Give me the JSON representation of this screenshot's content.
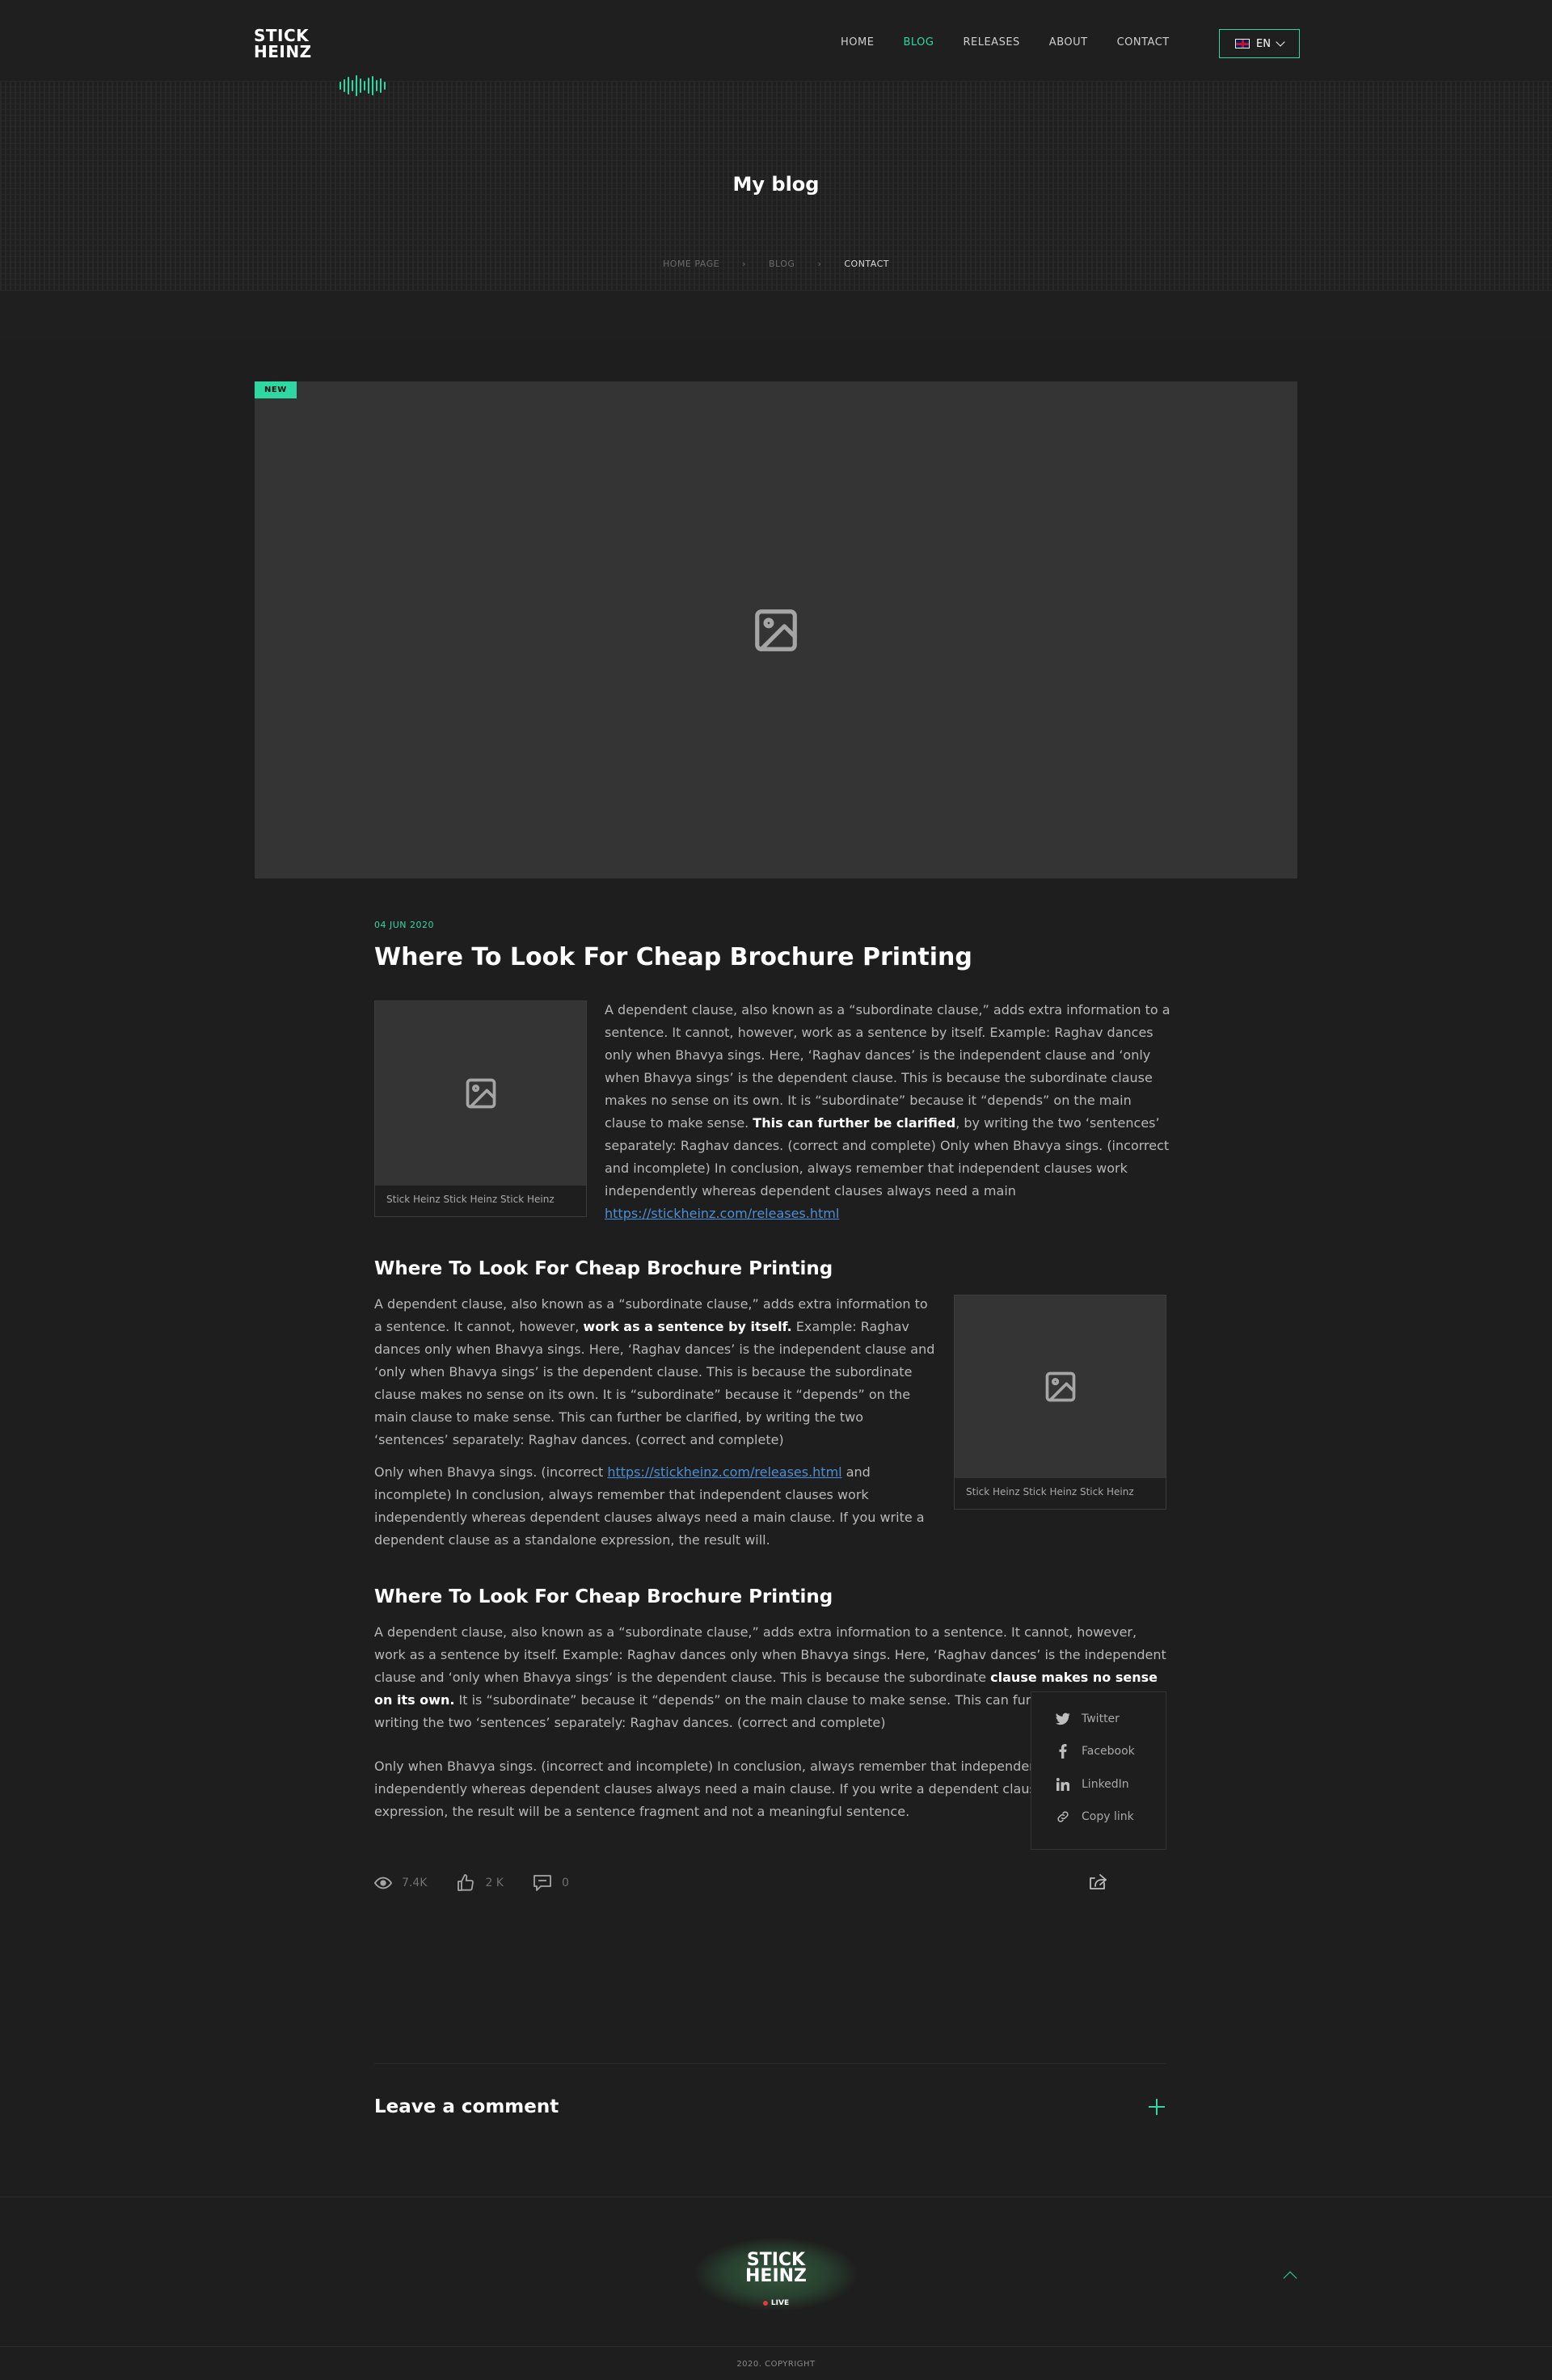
{
  "header": {
    "logo_line1": "STICK",
    "logo_line2": "HEINZ",
    "nav": [
      {
        "label": "HOME",
        "active": false
      },
      {
        "label": "BLOG",
        "active": true
      },
      {
        "label": "RELEASES",
        "active": false
      },
      {
        "label": "ABOUT",
        "active": false
      },
      {
        "label": "CONTACT",
        "active": false
      }
    ],
    "language": "EN",
    "accent_color": "#2ed8a3"
  },
  "hero": {
    "title": "My blog",
    "breadcrumb": [
      "HOME PAGE",
      "BLOG",
      "CONTACT"
    ]
  },
  "feature": {
    "badge": "NEW",
    "icon": "image-placeholder-icon"
  },
  "article": {
    "date": "04 JUN 2020",
    "title": "Where To Look For Cheap Brochure Printing",
    "figure1_caption": "Stick Heinz Stick Heinz Stick Heinz",
    "para1_a": "A dependent clause, also known as a “subordinate clause,” adds extra information to a sentence. It cannot, however, work as a sentence by itself. Example: Raghav dances only when Bhavya sings. Here, ‘Raghav dances’ is the independent clause and ‘only when Bhavya sings’ is the dependent clause. This is because the subordinate clause makes no sense on its own. It is “subordinate” because it “depends” on the main clause to make sense. ",
    "para1_bold": "This can further be clarified",
    "para1_b": ", by writing the two ‘sentences’ separately:  Raghav dances. (correct and complete) Only when Bhavya sings. (incorrect and incomplete) In conclusion, always remember that independent clauses work independently whereas dependent clauses always need a main  ",
    "para1_link": "https://stickheinz.com/releases.html",
    "section2_title": "Where To Look For Cheap Brochure Printing",
    "para2_a": "A dependent clause, also known as a “subordinate clause,” adds extra information to a sentence. It cannot, however, ",
    "para2_bold": "work as a sentence by itself.",
    "para2_b": " Example: Raghav dances only when Bhavya sings. Here, ‘Raghav dances’ is the independent clause and ‘only when Bhavya sings’ is the dependent clause. This is because the subordinate clause makes no sense on its own. It is “subordinate” because it “depends” on the main clause to make sense. This can further be clarified, by writing the two ‘sentences’ separately:  Raghav dances. (correct and complete)",
    "para3_a": "Only when Bhavya sings. (incorrect ",
    "para3_link": "https://stickheinz.com/releases.html",
    "para3_b": "  and incomplete) In conclusion, always remember that independent clauses work independently whereas   dependent clauses always need a main clause. If you write a dependent clause as a standalone expression, the result will.",
    "figure2_caption": "Stick Heinz Stick Heinz Stick Heinz",
    "section3_title": "Where To Look For Cheap Brochure Printing",
    "para4_a": "A dependent clause, also known as a “subordinate clause,” adds extra information to a sentence. It cannot, however, work as a sentence by itself. Example: Raghav dances only when Bhavya sings. Here, ‘Raghav dances’ is the independent clause and ‘only when Bhavya sings’ is the dependent clause. This is because the subordinate ",
    "para4_bold": "clause makes no sense on its own.",
    "para4_b": " It is “subordinate” because it “depends” on the main clause to make sense. This can further be clarified, by writing the two ‘sentences’ separately:  Raghav dances. (correct and complete)",
    "para5": "Only when Bhavya sings. (incorrect and incomplete) In conclusion, always remember that independent clauses work independently whereas dependent clauses always need a main clause. If you write a dependent clause as a standalone expression, the result will be a sentence fragment and not a meaningful sentence."
  },
  "share_menu": {
    "items": [
      {
        "label": "Twitter",
        "icon": "twitter-icon"
      },
      {
        "label": "Facebook",
        "icon": "facebook-icon"
      },
      {
        "label": "LinkedIn",
        "icon": "linkedin-icon"
      },
      {
        "label": "Copy link",
        "icon": "link-icon"
      }
    ]
  },
  "stats": {
    "views": "7.4K",
    "likes": "2 K",
    "comments": "0"
  },
  "comments": {
    "title": "Leave a comment"
  },
  "footer": {
    "logo_line1": "STICK",
    "logo_line2": "HEINZ",
    "live_label": "LIVE",
    "copyright": "2020. COPYRIGHT"
  }
}
